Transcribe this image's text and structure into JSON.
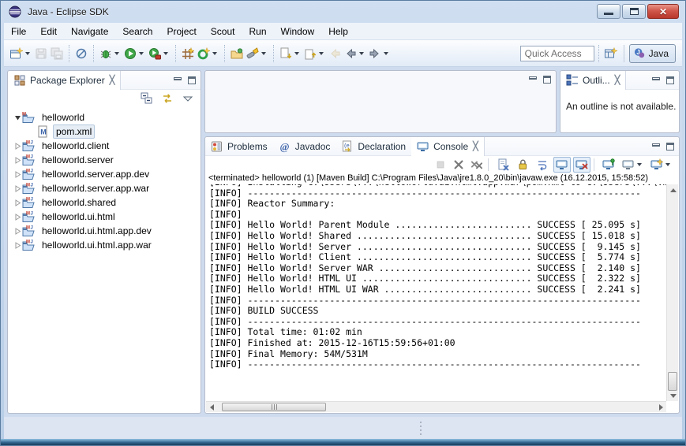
{
  "window": {
    "title": "Java - Eclipse SDK"
  },
  "menu_bar": [
    "File",
    "Edit",
    "Navigate",
    "Search",
    "Project",
    "Scout",
    "Run",
    "Window",
    "Help"
  ],
  "toolbar": {
    "quick_access_placeholder": "Quick Access",
    "perspective_label": "Java",
    "buttons": [
      {
        "name": "new-wizard",
        "dropdown": true
      },
      {
        "name": "save",
        "disabled": true
      },
      {
        "name": "save-all",
        "disabled": true
      },
      {
        "sep": true
      },
      {
        "name": "skip-all-breakpoints"
      },
      {
        "sep": true
      },
      {
        "name": "debug",
        "dropdown": true
      },
      {
        "name": "run",
        "dropdown": true
      },
      {
        "name": "run-external-tools",
        "dropdown": true
      },
      {
        "sep": true
      },
      {
        "name": "new-scout-object"
      },
      {
        "name": "scout-sdk",
        "dropdown": true
      },
      {
        "sep": true
      },
      {
        "name": "open-resource"
      },
      {
        "name": "search",
        "dropdown": true
      },
      {
        "sep": true
      },
      {
        "name": "next-annotation",
        "dropdown": true
      },
      {
        "name": "previous-annotation",
        "dropdown": true
      },
      {
        "name": "last-edit-location",
        "disabled": true
      },
      {
        "name": "back",
        "dropdown": true
      },
      {
        "name": "forward",
        "dropdown": true
      }
    ]
  },
  "package_explorer": {
    "title": "Package Explorer",
    "toolbar": [
      "collapse-all",
      "link-with-editor",
      "view-menu"
    ],
    "tree": [
      {
        "label": "helloworld",
        "depth": 0,
        "state": "expanded",
        "icon": "maven-folder"
      },
      {
        "label": "pom.xml",
        "depth": 1,
        "state": "leaf",
        "icon": "maven-file",
        "selected": true
      },
      {
        "label": "helloworld.client",
        "depth": 0,
        "state": "collapsed",
        "icon": "maven-java-folder"
      },
      {
        "label": "helloworld.server",
        "depth": 0,
        "state": "collapsed",
        "icon": "maven-java-folder"
      },
      {
        "label": "helloworld.server.app.dev",
        "depth": 0,
        "state": "collapsed",
        "icon": "maven-java-folder"
      },
      {
        "label": "helloworld.server.app.war",
        "depth": 0,
        "state": "collapsed",
        "icon": "maven-java-folder"
      },
      {
        "label": "helloworld.shared",
        "depth": 0,
        "state": "collapsed",
        "icon": "maven-java-folder"
      },
      {
        "label": "helloworld.ui.html",
        "depth": 0,
        "state": "collapsed",
        "icon": "maven-java-folder"
      },
      {
        "label": "helloworld.ui.html.app.dev",
        "depth": 0,
        "state": "collapsed",
        "icon": "maven-java-folder"
      },
      {
        "label": "helloworld.ui.html.app.war",
        "depth": 0,
        "state": "collapsed",
        "icon": "maven-java-folder"
      }
    ]
  },
  "outline": {
    "title": "Outli...",
    "message": "An outline is not available."
  },
  "console": {
    "tabs": [
      {
        "label": "Problems",
        "icon": "problems"
      },
      {
        "label": "Javadoc",
        "icon": "javadoc"
      },
      {
        "label": "Declaration",
        "icon": "declaration"
      },
      {
        "label": "Console",
        "icon": "console",
        "active": true,
        "closable": true
      }
    ],
    "toolbar": [
      {
        "name": "terminate",
        "disabled": true
      },
      {
        "name": "remove-launch"
      },
      {
        "name": "remove-all-terminated"
      },
      {
        "sep": true
      },
      {
        "name": "clear-console"
      },
      {
        "name": "scroll-lock"
      },
      {
        "name": "word-wrap"
      },
      {
        "name": "show-on-stdout",
        "pressed": true
      },
      {
        "name": "show-on-stderr",
        "pressed": true
      },
      {
        "sep": true
      },
      {
        "name": "pin-console"
      },
      {
        "name": "display-selected-console",
        "dropdown": true
      },
      {
        "name": "open-console",
        "dropdown": true
      }
    ],
    "status_line": "<terminated> helloworld (1) [Maven Build] C:\\Program Files\\Java\\jre1.8.0_20\\bin\\javaw.exe (16.12.2015, 15:58:52)",
    "clipped_line": "[INFO] Installing C:\\Users\\...\\helloworld.ui.html.app.war\\pom.xml to C:\\Users\\...\\.m2\\repository",
    "lines": [
      "[INFO] ------------------------------------------------------------------------",
      "[INFO] Reactor Summary:",
      "[INFO] ",
      "[INFO] Hello World! Parent Module ......................... SUCCESS [ 25.095 s]",
      "[INFO] Hello World! Shared ................................ SUCCESS [ 15.018 s]",
      "[INFO] Hello World! Server ................................ SUCCESS [  9.145 s]",
      "[INFO] Hello World! Client ................................ SUCCESS [  5.774 s]",
      "[INFO] Hello World! Server WAR ............................ SUCCESS [  2.140 s]",
      "[INFO] Hello World! HTML UI ............................... SUCCESS [  2.322 s]",
      "[INFO] Hello World! HTML UI WAR ........................... SUCCESS [  2.241 s]",
      "[INFO] ------------------------------------------------------------------------",
      "[INFO] BUILD SUCCESS",
      "[INFO] ------------------------------------------------------------------------",
      "[INFO] Total time: 01:02 min",
      "[INFO] Finished at: 2015-12-16T15:59:56+01:00",
      "[INFO] Final Memory: 54M/531M",
      "[INFO] ------------------------------------------------------------------------"
    ]
  },
  "colors": {
    "window_chrome": "#b7cde6",
    "workbench_bg": "#cedbee",
    "panel_border": "#b5bdcc",
    "selection_bg": "#e6edf5",
    "close_button": "#cf5246",
    "console_text": "#000000"
  }
}
